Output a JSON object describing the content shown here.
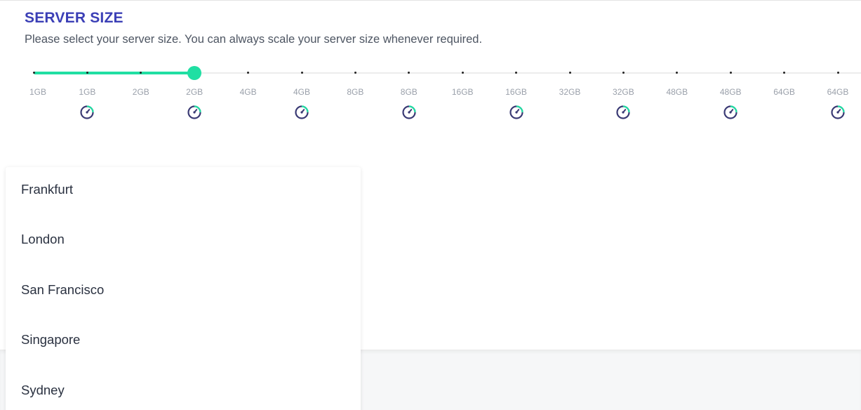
{
  "section": {
    "title": "SERVER SIZE",
    "subtitle": "Please select your server size. You can always scale your server size whenever required."
  },
  "slider": {
    "selected_index": 3,
    "accent_color": "#20dfa3",
    "steps": [
      "1GB",
      "1GB",
      "2GB",
      "2GB",
      "4GB",
      "4GB",
      "8GB",
      "8GB",
      "16GB",
      "16GB",
      "32GB",
      "32GB",
      "48GB",
      "48GB",
      "64GB",
      "64GB"
    ],
    "gauge_icons_on_odd_steps": true,
    "icon": "speedometer-gauge-icon"
  },
  "location_dropdown": {
    "items": [
      "Frankfurt",
      "London",
      "San Francisco",
      "Singapore",
      "Sydney"
    ]
  }
}
